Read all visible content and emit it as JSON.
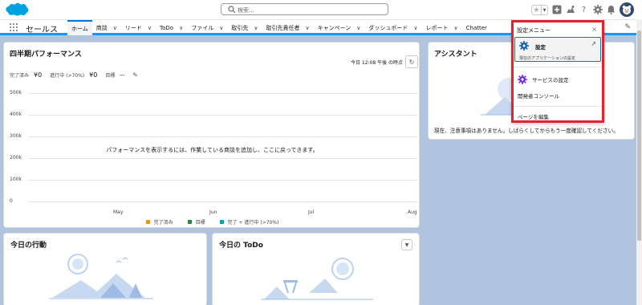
{
  "search": {
    "placeholder": "検索..."
  },
  "nav": {
    "app_name": "セールス",
    "tabs": [
      {
        "label": "ホーム",
        "active": true,
        "chevron": false
      },
      {
        "label": "商談",
        "chevron": true
      },
      {
        "label": "リード",
        "chevron": true
      },
      {
        "label": "ToDo",
        "chevron": true
      },
      {
        "label": "ファイル",
        "chevron": true
      },
      {
        "label": "取引先",
        "chevron": true
      },
      {
        "label": "取引先責任者",
        "chevron": true
      },
      {
        "label": "キャンペーン",
        "chevron": true
      },
      {
        "label": "ダッシュボード",
        "chevron": true
      },
      {
        "label": "レポート",
        "chevron": true
      },
      {
        "label": "Chatter",
        "chevron": false
      }
    ],
    "chevron_glyph": "∨"
  },
  "performance": {
    "title": "四半期パフォーマンス",
    "time": "今日 12:08 午後 の時点",
    "closed_label": "完了済み",
    "closed_value": "¥0",
    "open_label": "進行中 (>70%)",
    "open_value": "¥0",
    "goal_label": "目標",
    "goal_value": "--",
    "empty_message": "パフォーマンスを表示するには、作業している商談を追加し、ここに戻ってきます。"
  },
  "chart_data": {
    "type": "line",
    "categories": [
      "May",
      "Jun",
      "Jul",
      "Aug"
    ],
    "yticks": [
      "500k",
      "400k",
      "300k",
      "200k",
      "100k",
      "0"
    ],
    "ylim": [
      0,
      500000
    ],
    "series": [
      {
        "name": "完了済み",
        "values": [],
        "color": "#e29a26"
      },
      {
        "name": "目標",
        "values": [],
        "color": "#2e844a"
      },
      {
        "name": "完了 + 進行中 (>70%)",
        "values": [],
        "color": "#0b9fb5"
      }
    ],
    "legend": "bottom",
    "grid": true
  },
  "assistant": {
    "title": "アシスタント",
    "message": "現在、注意事項はありません。しばらくしてからもう一度確認してください。"
  },
  "today_events": {
    "title": "今日の行動"
  },
  "today_todo": {
    "title": "今日の ToDo"
  },
  "setup_menu": {
    "title": "設定メニュー",
    "close": "×",
    "setup_label": "設定",
    "setup_sub": "現在のアプリケーションの設定",
    "service_setup": "サービスの設定",
    "dev_console": "開発者コンソール",
    "edit_page": "ページを編集"
  },
  "colors": {
    "brand": "#0176d3",
    "header_bg": "#ffffff",
    "page_bg": "#b0c4df",
    "highlight": "#e0242e"
  }
}
